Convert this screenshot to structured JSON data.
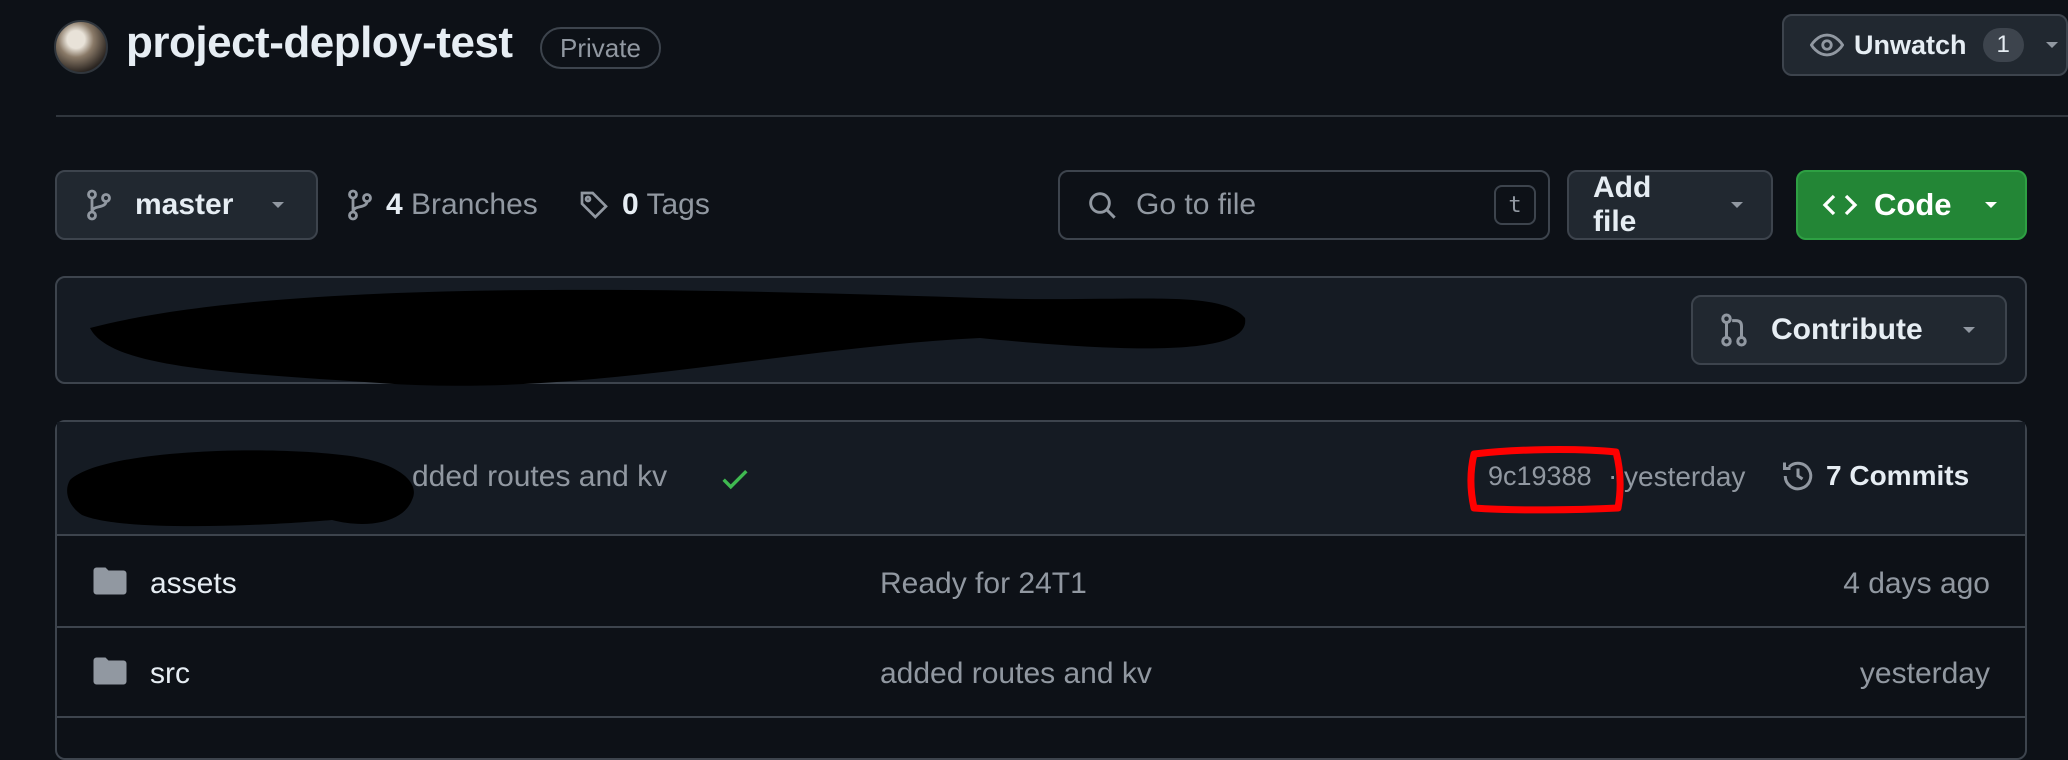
{
  "header": {
    "repo_name": "project-deploy-test",
    "visibility": "Private",
    "watch": {
      "label": "Unwatch",
      "count": "1"
    }
  },
  "toolbar": {
    "branch": "master",
    "branches": {
      "count": "4",
      "label": "Branches"
    },
    "tags": {
      "count": "0",
      "label": "Tags"
    },
    "search": {
      "placeholder": "Go to file",
      "shortcut": "t"
    },
    "add_file": "Add file",
    "code": "Code"
  },
  "banner": {
    "contribute": "Contribute"
  },
  "latest_commit": {
    "message": "dded routes and kv",
    "sha": "9c19388",
    "separator": "·",
    "time": "yesterday",
    "commits": "7 Commits"
  },
  "files": [
    {
      "name": "assets",
      "message": "Ready for 24T1",
      "time": "4 days ago"
    },
    {
      "name": "src",
      "message": "added routes and kv",
      "time": "yesterday"
    }
  ],
  "colors": {
    "background": "#0d1117",
    "border": "#3d444d",
    "primary_button": "#238636",
    "success_check": "#3fb950",
    "annotation_red": "#ff0000"
  }
}
